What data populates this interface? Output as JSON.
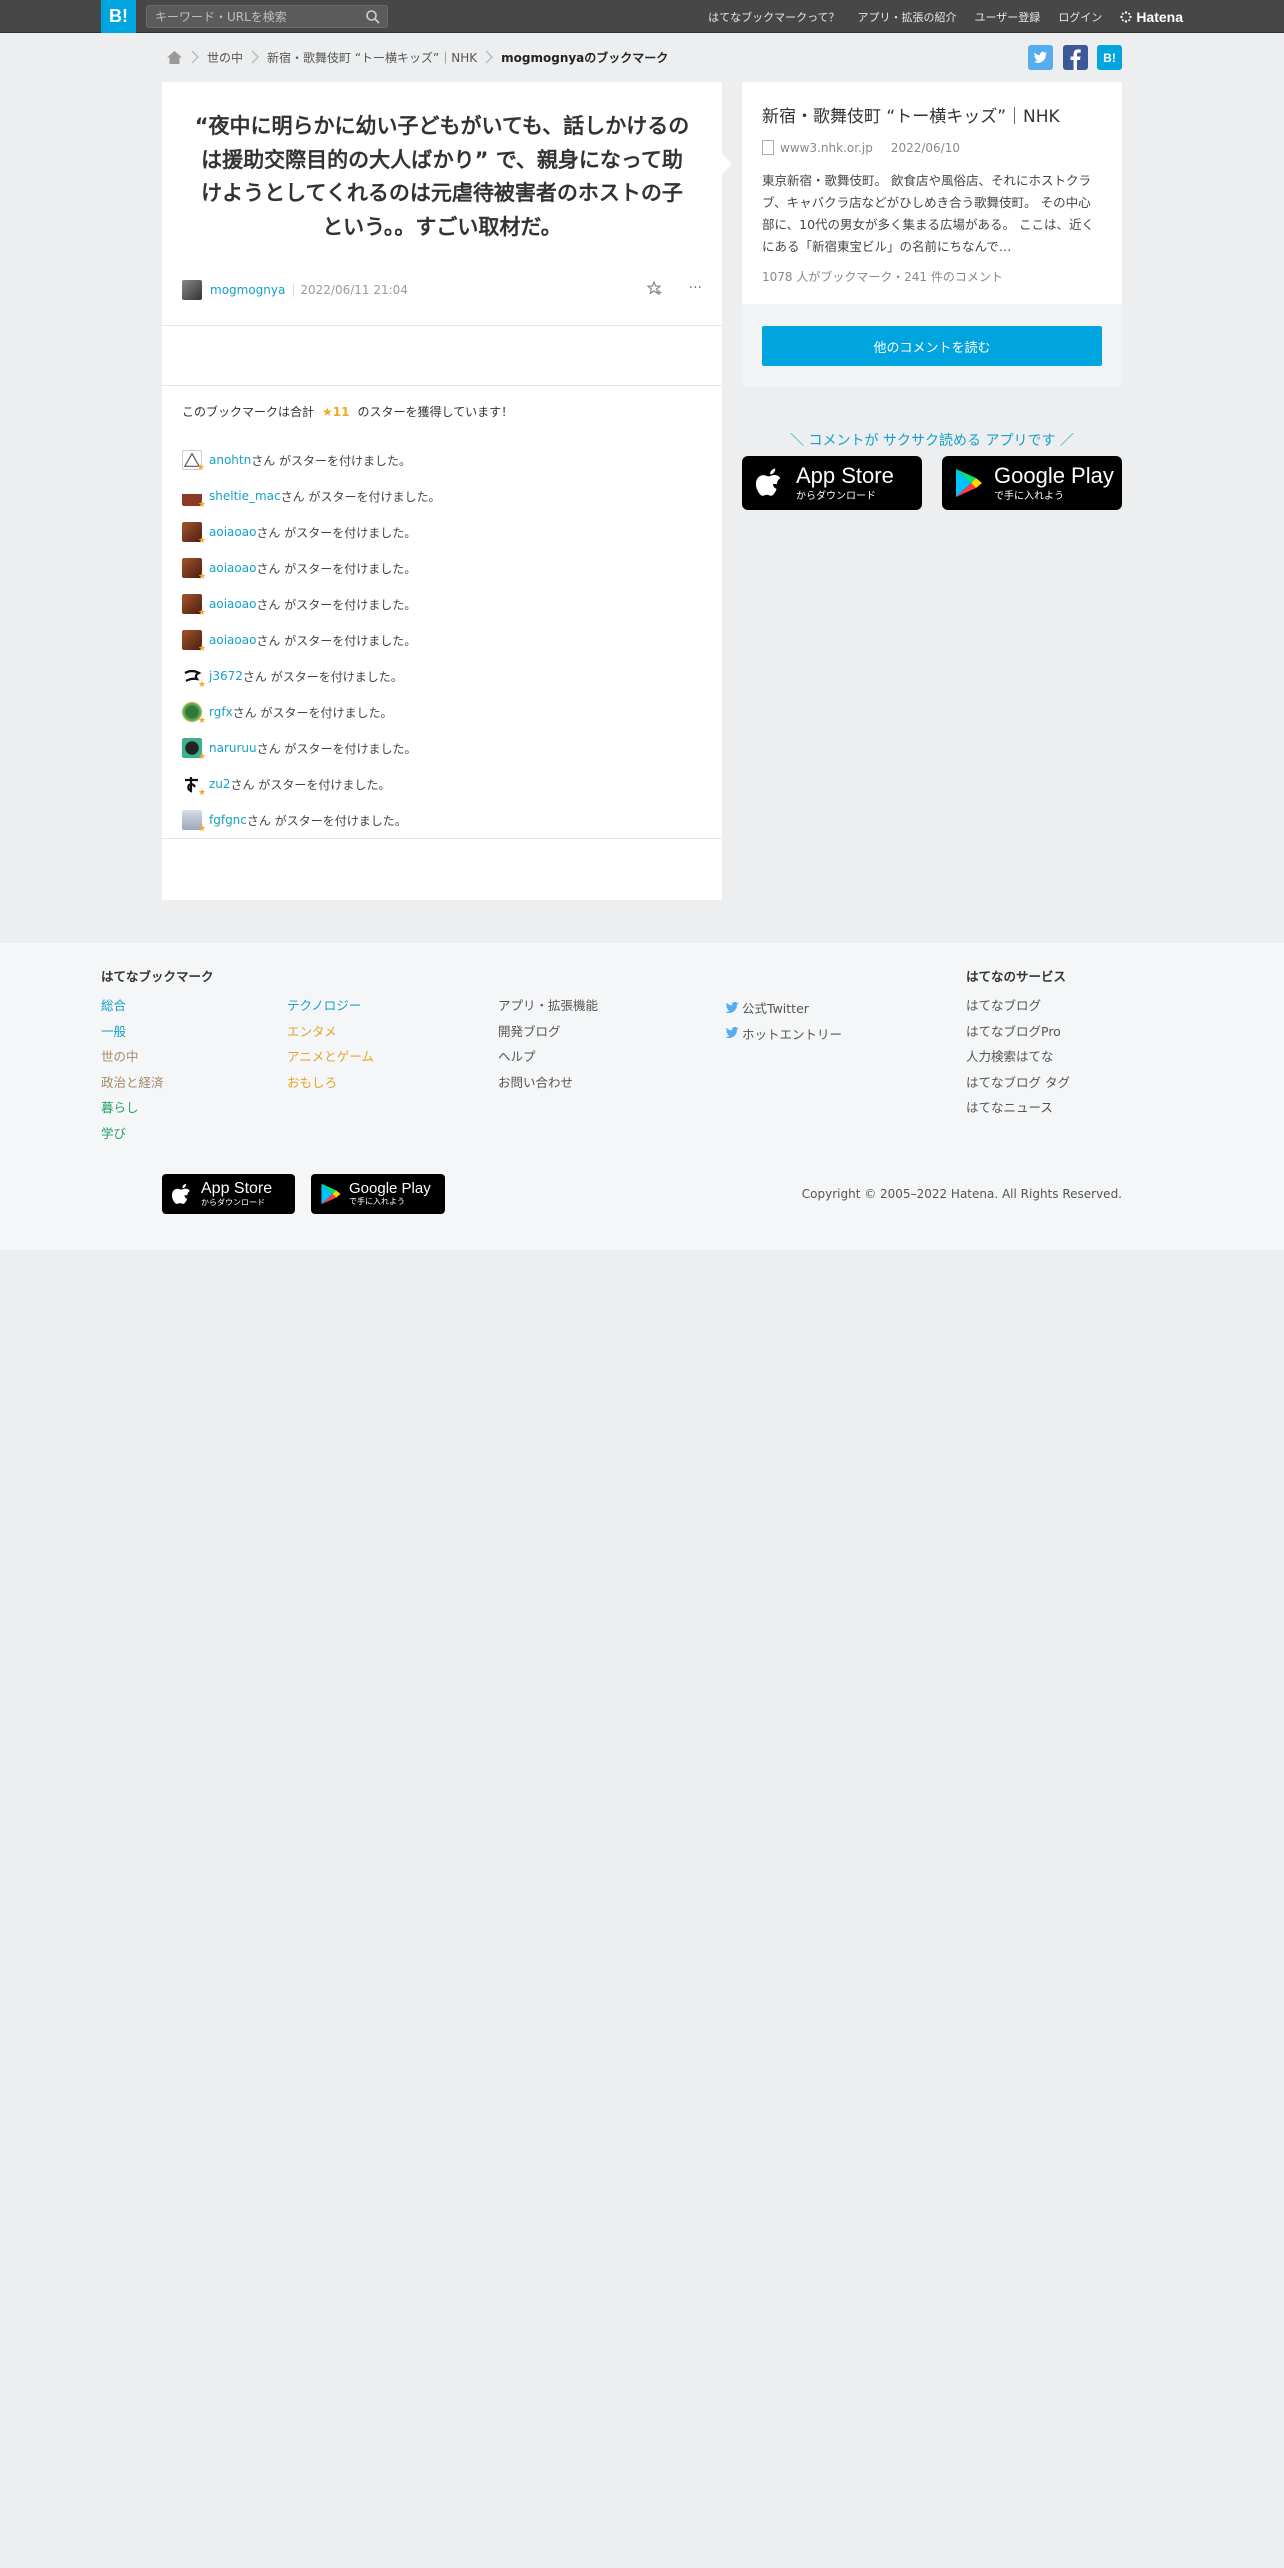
{
  "header": {
    "logo": "B!",
    "search_placeholder": "キーワード・URLを検索",
    "nav": [
      "はてなブックマークって？",
      "アプリ・拡張の紹介",
      "ユーザー登録",
      "ログイン"
    ],
    "hatena": "Hatena"
  },
  "breadcrumb": {
    "items": [
      "世の中",
      "新宿・歌舞伎町 “トー横キッズ”｜NHK"
    ],
    "current": "mogmognyaのブックマーク"
  },
  "bookmark": {
    "comment": "“夜中に明らかに幼い子どもがいても、話しかけるのは援助交際目的の大人ばかり” で、親身になって助けようとしてくれるのは元虐待被害者のホストの子という。。すごい取材だ。",
    "user": "mogmognya",
    "date": "2022/06/11 21:04",
    "more": "···"
  },
  "stars": {
    "head_prefix": "このブックマークは合計",
    "count": "★11",
    "head_suffix": "のスターを獲得しています！",
    "suffix": "さん がスターを付けました。",
    "users": [
      "anohtn",
      "sheltie_mac",
      "aoiaoao",
      "aoiaoao",
      "aoiaoao",
      "aoiaoao",
      "j3672",
      "rgfx",
      "naruruu",
      "zu2",
      "fgfgnc"
    ]
  },
  "entry": {
    "title": "新宿・歌舞伎町 “トー横キッズ”｜NHK",
    "domain": "www3.nhk.or.jp",
    "date": "2022/06/10",
    "description": "東京新宿・歌舞伎町。 飲食店や風俗店、それにホストクラブ、キャバクラ店などがひしめき合う歌舞伎町。 その中心部に、10代の男女が多く集まる広場がある。 ここは、近くにある「新宿東宝ビル」の名前にちなんで…",
    "count_text": "1078 人がブックマーク・241 件のコメント",
    "read_button": "他のコメントを読む"
  },
  "promo": {
    "text": "＼ コメントが サクサク読める アプリです ／",
    "appstore_big": "App Store",
    "appstore_small": "からダウンロード",
    "googleplay_big": "Google Play",
    "googleplay_small": "で手に入れよう"
  },
  "footer": {
    "heading_bookmark": "はてなブックマーク",
    "col1": [
      "総合",
      "一般",
      "世の中",
      "政治と経済",
      "暮らし",
      "学び"
    ],
    "col2": [
      "テクノロジー",
      "エンタメ",
      "アニメとゲーム",
      "おもしろ"
    ],
    "col3": [
      "アプリ・拡張機能",
      "開発ブログ",
      "ヘルプ",
      "お問い合わせ"
    ],
    "col4": [
      "公式Twitter",
      "ホットエントリー"
    ],
    "heading_services": "はてなのサービス",
    "col5": [
      "はてなブログ",
      "はてなブログPro",
      "人力検索はてな",
      "はてなブログ タグ",
      "はてなニュース"
    ],
    "copyright": "Copyright © 2005–2022 Hatena. All Rights Reserved."
  }
}
